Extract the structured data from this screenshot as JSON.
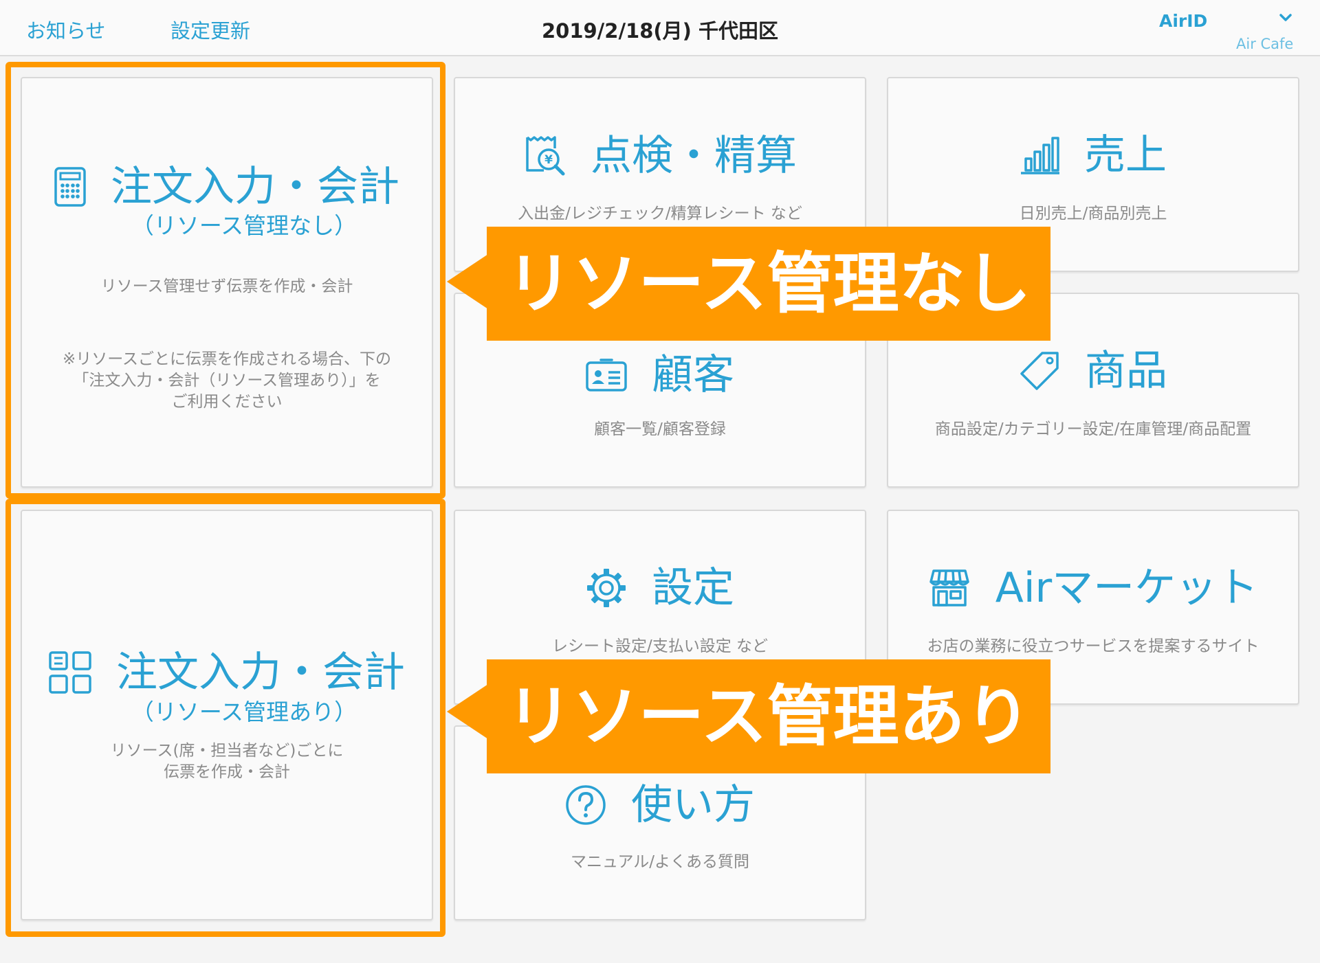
{
  "header": {
    "news": "お知らせ",
    "update_settings": "設定更新",
    "date_location": "2019/2/18(月) 千代田区",
    "airid": "AirID",
    "store": "Air Cafe"
  },
  "tiles": {
    "order_no_resource": {
      "title": "注文入力・会計",
      "subtitle": "（リソース管理なし）",
      "desc": "リソース管理せず伝票を作成・会計",
      "note_lines": [
        "※リソースごとに伝票を作成される場合、下の",
        "「注文入力・会計（リソース管理あり）」を",
        "ご利用ください"
      ]
    },
    "inspection": {
      "title": "点検・精算",
      "desc": "入出金/レジチェック/精算レシート など"
    },
    "sales": {
      "title": "売上",
      "desc": "日別売上/商品別売上"
    },
    "customer": {
      "title": "顧客",
      "desc": "顧客一覧/顧客登録"
    },
    "product": {
      "title": "商品",
      "desc": "商品設定/カテゴリー設定/在庫管理/商品配置"
    },
    "order_resource": {
      "title": "注文入力・会計",
      "subtitle": "（リソース管理あり）",
      "desc_lines": [
        "リソース(席・担当者など)ごとに",
        "伝票を作成・会計"
      ]
    },
    "settings": {
      "title": "設定",
      "desc": "レシート設定/支払い設定 など"
    },
    "market": {
      "title": "Airマーケット",
      "desc": "お店の業務に役立つサービスを提案するサイト"
    },
    "howto": {
      "title": "使い方",
      "desc": "マニュアル/よくある質問"
    }
  },
  "callouts": {
    "no_resource": "リソース管理なし",
    "with_resource": "リソース管理あり"
  },
  "colors": {
    "accent": "#2aa1d3",
    "highlight": "#ff9900"
  },
  "icons": [
    "calculator-icon",
    "receipt-search-icon",
    "bar-chart-icon",
    "id-card-icon",
    "tag-icon",
    "grid-icon",
    "gear-icon",
    "store-icon",
    "help-icon",
    "chevron-down-icon"
  ]
}
